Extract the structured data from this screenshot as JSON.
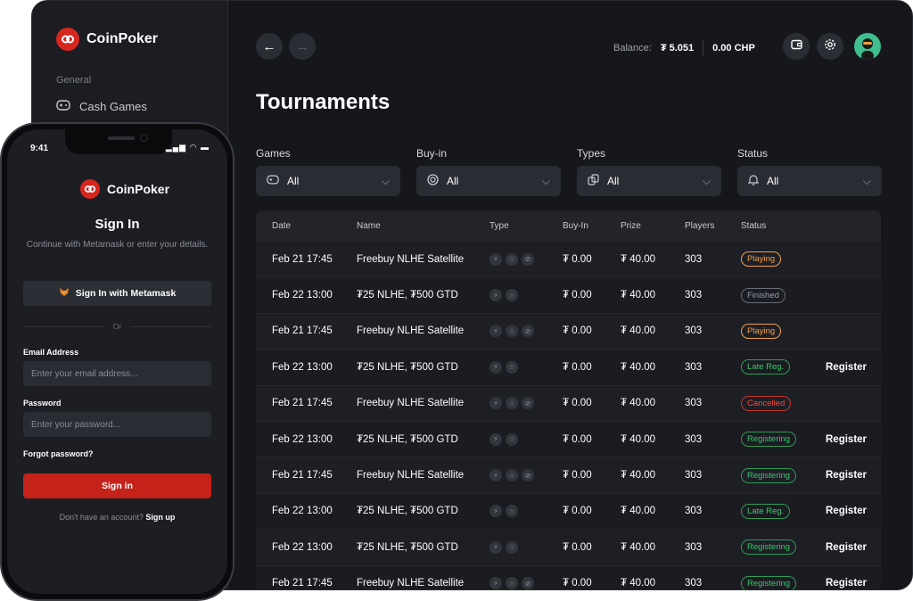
{
  "brand": {
    "name": "CoinPoker",
    "accent": "#d6261e"
  },
  "sidebar": {
    "section": "General",
    "items": [
      {
        "label": "Cash Games",
        "icon": "gamepad-icon"
      }
    ]
  },
  "topbar": {
    "balance_label": "Balance:",
    "balance_value": "₮ 5.051",
    "chp_value": "0.00 CHP"
  },
  "page": {
    "title": "Tournaments"
  },
  "filters": [
    {
      "label": "Games",
      "value": "All",
      "icon": "gamepad-icon"
    },
    {
      "label": "Buy-in",
      "value": "All",
      "icon": "coin-icon"
    },
    {
      "label": "Types",
      "value": "All",
      "icon": "cards-icon"
    },
    {
      "label": "Status",
      "value": "All",
      "icon": "bell-icon"
    }
  ],
  "table": {
    "columns": [
      "Date",
      "Name",
      "Type",
      "Buy-In",
      "Prize",
      "Players",
      "Status"
    ],
    "rows": [
      {
        "date": "Feb 21 17:45",
        "name": "Freebuy NLHE Satellite",
        "types": 3,
        "buyin": "₮ 0.00",
        "prize": "₮ 40.00",
        "players": "303",
        "status": "Playing",
        "status_kind": "playing",
        "action": ""
      },
      {
        "date": "Feb 22 13:00",
        "name": "₮25 NLHE, ₮500 GTD",
        "types": 2,
        "buyin": "₮ 0.00",
        "prize": "₮ 40.00",
        "players": "303",
        "status": "Finished",
        "status_kind": "finished",
        "action": ""
      },
      {
        "date": "Feb 21 17:45",
        "name": "Freebuy NLHE Satellite",
        "types": 3,
        "buyin": "₮ 0.00",
        "prize": "₮ 40.00",
        "players": "303",
        "status": "Playing",
        "status_kind": "playing",
        "action": ""
      },
      {
        "date": "Feb 22 13:00",
        "name": "₮25 NLHE, ₮500 GTD",
        "types": 2,
        "buyin": "₮ 0.00",
        "prize": "₮ 40.00",
        "players": "303",
        "status": "Late Reg.",
        "status_kind": "late",
        "action": "Register"
      },
      {
        "date": "Feb 21 17:45",
        "name": "Freebuy NLHE Satellite",
        "types": 3,
        "buyin": "₮ 0.00",
        "prize": "₮ 40.00",
        "players": "303",
        "status": "Cancelled",
        "status_kind": "cancelled",
        "action": ""
      },
      {
        "date": "Feb 22 13:00",
        "name": "₮25 NLHE, ₮500 GTD",
        "types": 2,
        "buyin": "₮ 0.00",
        "prize": "₮ 40.00",
        "players": "303",
        "status": "Registering",
        "status_kind": "registering",
        "action": "Register"
      },
      {
        "date": "Feb 21 17:45",
        "name": "Freebuy NLHE Satellite",
        "types": 3,
        "buyin": "₮ 0.00",
        "prize": "₮ 40.00",
        "players": "303",
        "status": "Registering",
        "status_kind": "registering",
        "action": "Register"
      },
      {
        "date": "Feb 22 13:00",
        "name": "₮25 NLHE, ₮500 GTD",
        "types": 2,
        "buyin": "₮ 0.00",
        "prize": "₮ 40.00",
        "players": "303",
        "status": "Late Reg.",
        "status_kind": "late",
        "action": "Register"
      },
      {
        "date": "Feb 22 13:00",
        "name": "₮25 NLHE, ₮500 GTD",
        "types": 2,
        "buyin": "₮ 0.00",
        "prize": "₮ 40.00",
        "players": "303",
        "status": "Registering",
        "status_kind": "registering",
        "action": "Register"
      },
      {
        "date": "Feb 21 17:45",
        "name": "Freebuy NLHE Satellite",
        "types": 3,
        "buyin": "₮ 0.00",
        "prize": "₮ 40.00",
        "players": "303",
        "status": "Registering",
        "status_kind": "registering",
        "action": "Register"
      }
    ]
  },
  "phone": {
    "time": "9:41",
    "title": "Sign In",
    "subtitle": "Continue with Metamask or enter your details.",
    "metamask_label": "Sign In with Metamask",
    "or_label": "Or",
    "email_label": "Email Address",
    "email_placeholder": "Enter your email address...",
    "password_label": "Password",
    "password_placeholder": "Enter your password...",
    "forgot_label": "Forgot password?",
    "signin_label": "Sign in",
    "signup_prompt": "Don't have an account?",
    "signup_link": "Sign up"
  }
}
